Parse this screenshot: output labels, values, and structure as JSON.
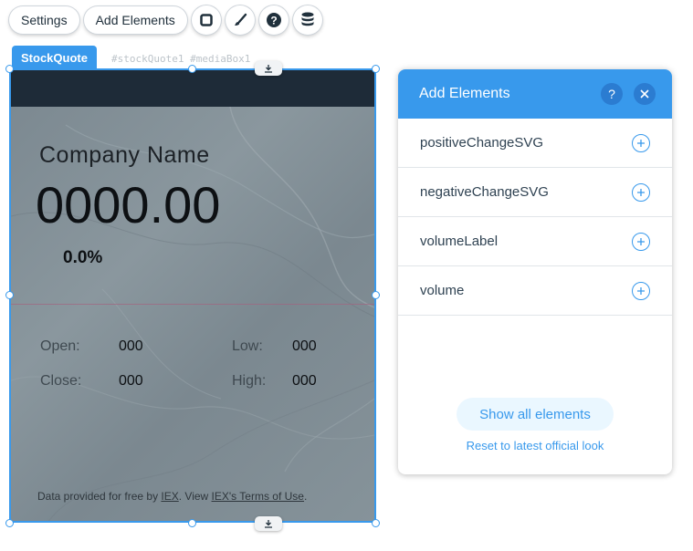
{
  "toolbar": {
    "settings_label": "Settings",
    "add_elements_label": "Add Elements"
  },
  "component": {
    "tag": "StockQuote",
    "ids": "#stockQuote1  #mediaBox1"
  },
  "widget": {
    "company_name": "Company Name",
    "price": "0000.00",
    "change_pct": "0.0%",
    "stats": {
      "open_label": "Open:",
      "open_value": "000",
      "low_label": "Low:",
      "low_value": "000",
      "close_label": "Close:",
      "close_value": "000",
      "high_label": "High:",
      "high_value": "000"
    },
    "footer": {
      "prefix": "Data provided for free by ",
      "iex_link": "IEX",
      "mid": ". View ",
      "terms_link": "IEX's Terms of Use",
      "suffix": "."
    }
  },
  "panel": {
    "title": "Add Elements",
    "help_glyph": "?",
    "items": [
      {
        "label": "positiveChangeSVG"
      },
      {
        "label": "negativeChangeSVG"
      },
      {
        "label": "volumeLabel"
      },
      {
        "label": "volume"
      }
    ],
    "show_all_label": "Show all elements",
    "reset_label": "Reset to latest official look"
  },
  "colors": {
    "accent": "#3899ec",
    "widget_header": "#1e2b38",
    "marble": "#86939a"
  }
}
